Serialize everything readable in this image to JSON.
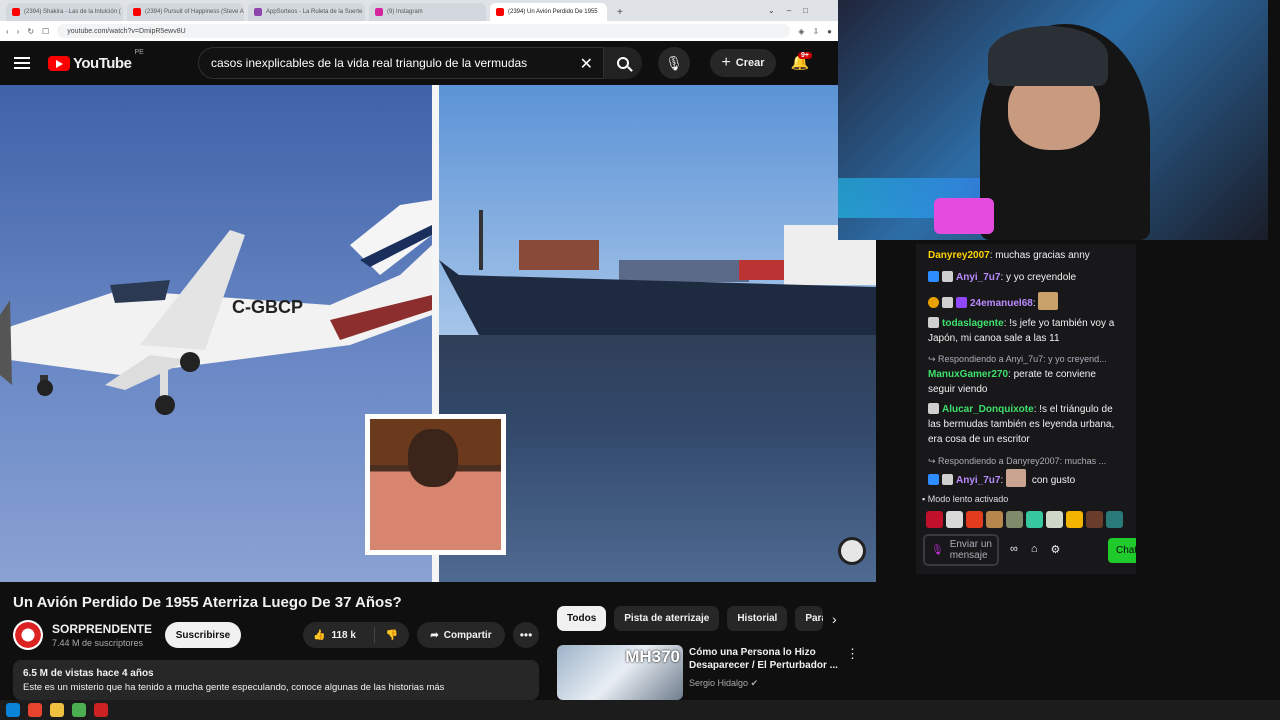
{
  "browser": {
    "tabs": [
      {
        "label": "(2394) Shakira - Las de la Intuición (",
        "active": false,
        "favicon_color": "#ff0000"
      },
      {
        "label": "(2394) Pursuit of Happiness (Steve A",
        "active": false,
        "favicon_color": "#ff0000"
      },
      {
        "label": "AppSorteos - La Ruleta de la Suerte",
        "active": false,
        "favicon_color": "#8e44ad"
      },
      {
        "label": "(9) Instagram",
        "active": false,
        "favicon_color": "#d6249f"
      },
      {
        "label": "(2394) Un Avión Perdido De 1955",
        "active": true,
        "favicon_color": "#ff0000"
      }
    ],
    "new_tab": "+",
    "url": "youtube.com/watch?v=DmipR5ewv8U"
  },
  "youtube": {
    "logo": "YouTube",
    "country": "PE",
    "search_value": "casos inexplicables de la vida real triangulo de la vermudas",
    "create_label": "Crear",
    "notif_count": "9+"
  },
  "video": {
    "plane_reg": "C-GBCP",
    "title": "Un Avión Perdido De 1955 Aterriza Luego De 37 Años?",
    "channel": "SORPRENDENTE",
    "subscribers": "7.44 M de suscriptores",
    "subscribe_label": "Suscribirse",
    "likes": "118 k",
    "share_label": "Compartir",
    "views_line": "6.5 M de vistas  hace 4 años",
    "description": "Este es un misterio que ha tenido a mucha gente especulando, conoce algunas de las historias más"
  },
  "chips": [
    "Todos",
    "Pista de aterrizaje",
    "Historial",
    "Para ti"
  ],
  "recommendation": {
    "badge": "MH370",
    "title": "Cómo una Persona lo Hizo Desaparecer / El Perturbador ...",
    "channel": "Sergio Hidalgo"
  },
  "chat": {
    "messages": [
      {
        "user": "Danyrey2007",
        "user_color": "#ffd400",
        "text": "muchas gracias anny"
      },
      {
        "user": "Anyi_7u7",
        "user_color": "#b98cff",
        "text": "y yo creyendole"
      },
      {
        "user": "24emanuel68",
        "user_color": "#b98cff",
        "text": ""
      },
      {
        "user": "todaslagente",
        "user_color": "#3ee06b",
        "text": "!s jefe yo también voy a Japón, mi canoa sale a las 11"
      },
      {
        "reply": "Respondiendo a Anyi_7u7: y yo creyend...",
        "user": "ManuxGamer270",
        "user_color": "#3ee06b",
        "text": "perate te conviene seguir viendo"
      },
      {
        "user": "Alucar_Donquixote",
        "user_color": "#3ee06b",
        "text": "!s el triángulo de las bermudas también es leyenda urbana, era cosa de un escritor"
      },
      {
        "reply": "Respondiendo a Danyrey2007: muchas ...",
        "user": "Anyi_7u7",
        "user_color": "#b98cff",
        "text": "con gusto"
      }
    ],
    "slow_mode": "Modo lento activado",
    "input_placeholder": "Enviar un mensaje",
    "chat_button": "Chat"
  }
}
